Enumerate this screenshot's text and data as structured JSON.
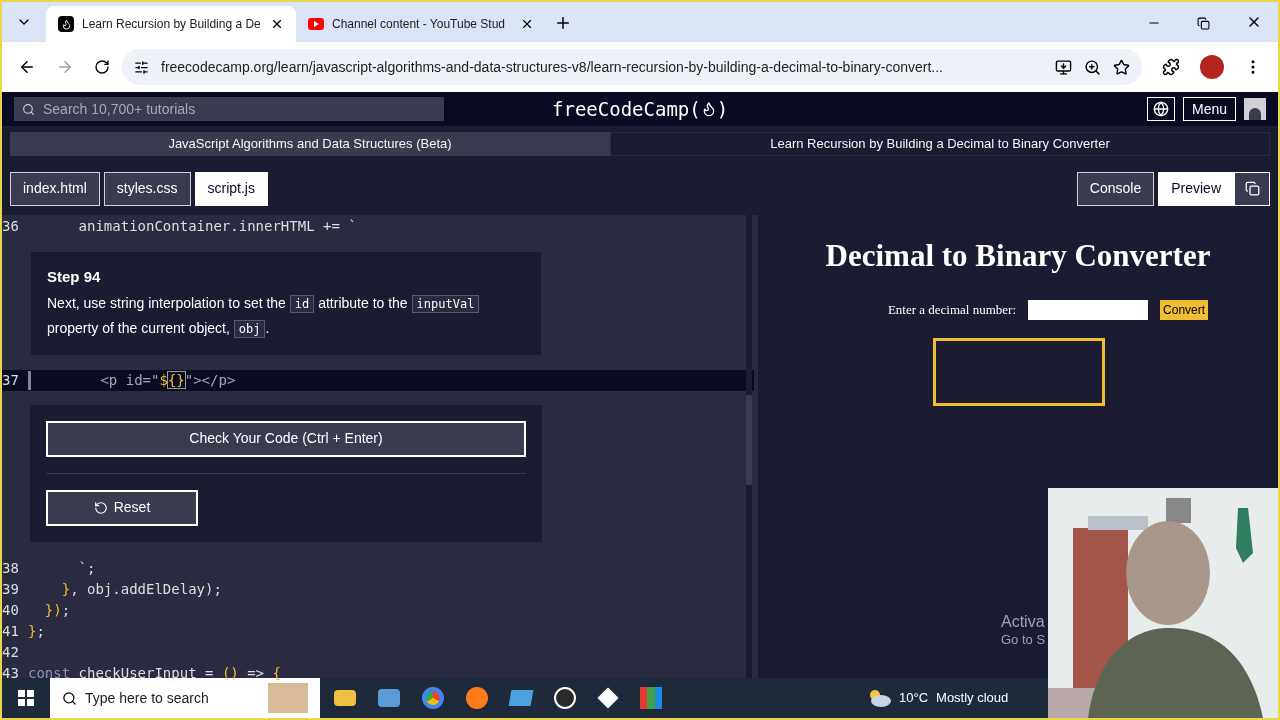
{
  "browser": {
    "tabs": [
      {
        "title": "Learn Recursion by Building a De",
        "selected": true,
        "kind": "fcc"
      },
      {
        "title": "Channel content - YouTube Stud",
        "selected": false,
        "kind": "youtube"
      }
    ],
    "address": "freecodecamp.org/learn/javascript-algorithms-and-data-structures-v8/learn-recursion-by-building-a-decimal-to-binary-convert..."
  },
  "site": {
    "search_placeholder": "Search 10,700+ tutorials",
    "logo": [
      "freeCodeCamp(",
      ")"
    ],
    "menu": "Menu",
    "breadcrumb": [
      "JavaScript Algorithms and Data Structures (Beta)",
      "Learn Recursion by Building a Decimal to Binary Converter"
    ]
  },
  "file_tabs": [
    {
      "label": "index.html",
      "selected": false
    },
    {
      "label": "styles.css",
      "selected": false
    },
    {
      "label": "script.js",
      "selected": true
    }
  ],
  "view_tabs": [
    {
      "label": "Console",
      "selected": false
    },
    {
      "label": "Preview",
      "selected": true
    }
  ],
  "editor": {
    "lines_before": [
      {
        "number": "36",
        "tokens": [
          {
            "text": "      animationContainer.innerHTML += `",
            "kind": "plain"
          }
        ]
      }
    ],
    "step": {
      "title": "Step 94",
      "description": [
        {
          "text": "Next, use string interpolation to set the ",
          "kind": "text"
        },
        {
          "text": "id",
          "kind": "code"
        },
        {
          "text": " attribute to the ",
          "kind": "text"
        },
        {
          "text": "inputVal",
          "kind": "code"
        },
        {
          "text": " property of the current object, ",
          "kind": "text"
        },
        {
          "text": "obj",
          "kind": "code"
        },
        {
          "text": ".",
          "kind": "text"
        }
      ]
    },
    "active_line": {
      "number": "37",
      "tokens": [
        {
          "text": "        <p id=\"",
          "kind": "tag"
        },
        {
          "text": "$",
          "kind": "accent"
        },
        {
          "text": "{}",
          "kind": "match"
        },
        {
          "text": "\"></p>",
          "kind": "tag"
        }
      ]
    },
    "check_button": "Check Your Code (Ctrl + Enter)",
    "reset_button": "Reset",
    "lines_after": [
      {
        "number": "38",
        "tokens": [
          {
            "text": "      `;",
            "kind": "plain"
          }
        ]
      },
      {
        "number": "39",
        "tokens": [
          {
            "text": "    }",
            "kind": "accent"
          },
          {
            "text": ", obj.addElDelay);",
            "kind": "plain"
          }
        ]
      },
      {
        "number": "40",
        "tokens": [
          {
            "text": "  })",
            "kind": "accent"
          },
          {
            "text": ";",
            "kind": "plain"
          }
        ]
      },
      {
        "number": "41",
        "tokens": [
          {
            "text": "}",
            "kind": "accent"
          },
          {
            "text": ";",
            "kind": "plain"
          }
        ]
      },
      {
        "number": "42"
      },
      {
        "number": "43",
        "tokens": [
          {
            "text": "const",
            "kind": "keyword"
          },
          {
            "text": " checkUserInput = ",
            "kind": "plain"
          },
          {
            "text": "()",
            "kind": "accent"
          },
          {
            "text": " => ",
            "kind": "plain"
          },
          {
            "text": "{",
            "kind": "accent"
          }
        ]
      }
    ]
  },
  "preview": {
    "title": "Decimal to Binary Converter",
    "label": "Enter a decimal number:",
    "button": "Convert",
    "activation": [
      "Activa",
      "Go to S"
    ]
  },
  "taskbar": {
    "search_placeholder": "Type here to search",
    "temperature": "10°C",
    "weather": "Mostly cloud"
  }
}
